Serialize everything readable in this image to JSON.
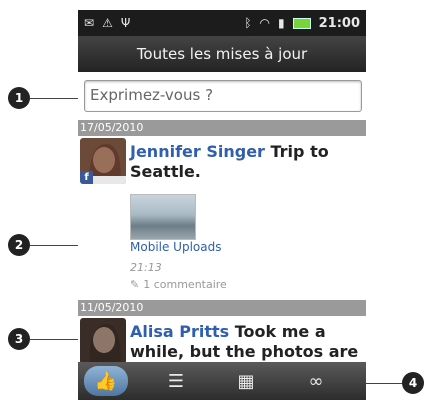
{
  "status_bar": {
    "time": "21:00"
  },
  "title": "Toutes les mises à jour",
  "compose": {
    "placeholder": "Exprimez-vous ?"
  },
  "posts": [
    {
      "date": "17/05/2010",
      "author": "Jennifer Singer",
      "text": " Trip to Seattle.",
      "album": "Mobile Uploads",
      "time": "21:13",
      "comments": "1 commentaire"
    },
    {
      "date": "11/05/2010",
      "author": "Alisa Pritts",
      "text": " Took me a while, but the photos are"
    }
  ],
  "callouts": [
    "1",
    "2",
    "3",
    "4"
  ]
}
